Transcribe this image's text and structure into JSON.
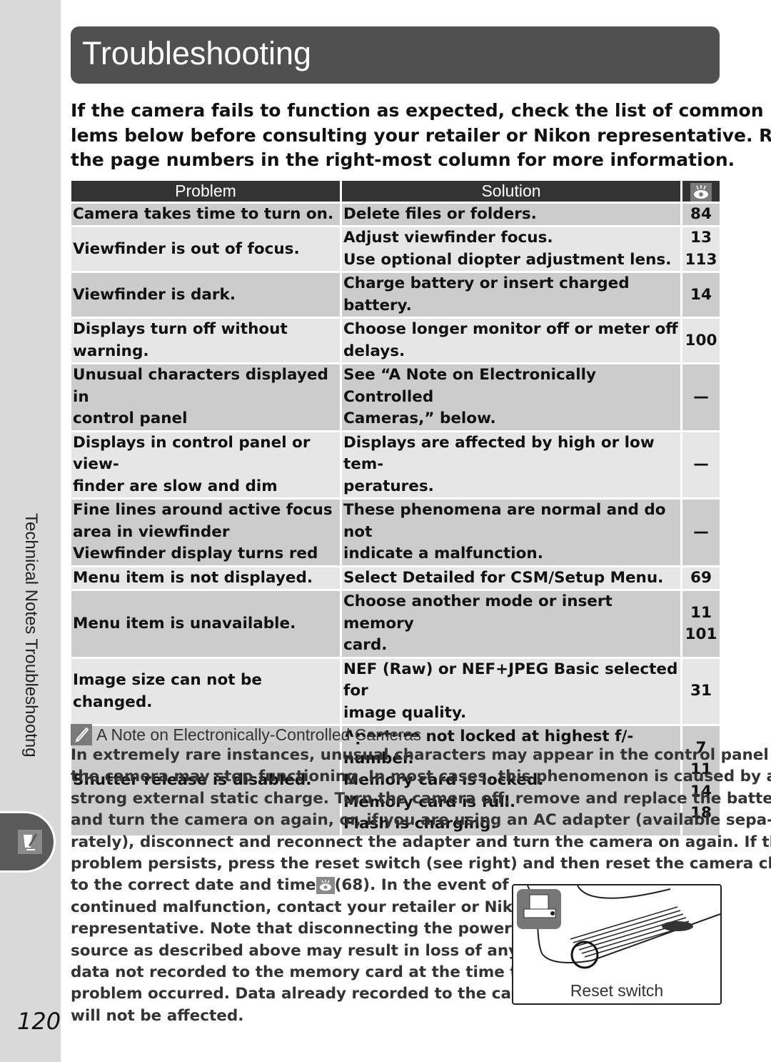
{
  "page": {
    "title": "Troubleshooting",
    "number": "120",
    "side_label": "Technical Notes Troubleshootng"
  },
  "intro": {
    "lines": [
      "If the camera fails to function as expected, check the list of common prob-",
      "lems below before consulting your retailer or Nikon representative.  Refer to",
      "the page numbers in the right-most column for more information."
    ]
  },
  "table": {
    "headers": {
      "problem": "Problem",
      "solution": "Solution",
      "page_icon": "eye-icon"
    },
    "rows": [
      {
        "problem": [
          "Camera takes time to turn on."
        ],
        "solutions": [
          "Delete files or folders."
        ],
        "pages": [
          "84"
        ]
      },
      {
        "problem": [
          "Viewfinder is out of focus."
        ],
        "solutions": [
          "Adjust viewfinder focus.",
          "Use optional diopter adjustment lens."
        ],
        "pages": [
          "13",
          "113"
        ]
      },
      {
        "problem": [
          "Viewfinder is dark."
        ],
        "solutions": [
          "Charge battery or insert charged battery."
        ],
        "pages": [
          "14"
        ]
      },
      {
        "problem": [
          "Displays turn off without warning."
        ],
        "solutions": [
          "Choose longer monitor off or meter off",
          "delays."
        ],
        "pages": [
          "100"
        ]
      },
      {
        "problem": [
          "Unusual characters displayed in",
          "control panel"
        ],
        "solutions": [
          "See “A Note on Electronically Controlled",
          "Cameras,” below."
        ],
        "pages": [
          "—"
        ]
      },
      {
        "problem": [
          "Displays in control panel or view-",
          "finder are slow and dim"
        ],
        "solutions": [
          "Displays are affected by high or low tem-",
          "peratures."
        ],
        "pages": [
          "—"
        ]
      },
      {
        "problem": [
          "Fine lines around active focus",
          " area in viewfinder",
          "Viewfinder display turns red"
        ],
        "solutions": [
          "These phenomena are normal and do not",
          "indicate a malfunction."
        ],
        "pages": [
          "—"
        ]
      },
      {
        "problem": [
          "Menu item is not displayed."
        ],
        "solutions": [
          "Select Detailed for CSM/Setup Menu."
        ],
        "pages": [
          "69"
        ]
      },
      {
        "problem": [
          "Menu item is unavailable."
        ],
        "solutions": [
          "Choose another mode or insert memory",
          "card."
        ],
        "pages": [
          "11",
          "101"
        ]
      },
      {
        "problem": [
          "Image size can not be changed."
        ],
        "solutions": [
          "NEF (Raw) or NEF+JPEG Basic selected for",
          "image quality."
        ],
        "pages": [
          "31"
        ]
      },
      {
        "problem": [
          "Shutter release is disabled."
        ],
        "solutions": [
          "Aperture not locked at highest f/-number.",
          "Memory card is locked.",
          "Memory card is full.",
          "Flash is charging."
        ],
        "pages": [
          "7",
          "11",
          "14",
          "18"
        ]
      }
    ]
  },
  "note": {
    "icon": "pencil-note-icon",
    "title": "A Note on Electronically-Controlled Cameras",
    "lines": [
      "In extremely rare instances, unusual characters may appear in the control panel and",
      "the camera may stop functioning.  In most cases, this phenomenon is caused by a",
      "strong external static charge.  Turn the camera off, remove and replace the battery,",
      "and turn the camera on again, or, if you are using an AC adapter (available sepa-",
      "rately), disconnect and reconnect the adapter and turn the camera on again.  If the",
      "problem persists, press the reset switch (see right) and then reset the camera clock",
      "to the correct date and time",
      "continued malfunction, contact your retailer or Nikon",
      "representative.   Note that disconnecting the power",
      "source as described above may result in loss of any",
      "data not recorded to the memory card at the time the",
      "problem occurred.  Data already recorded to the card",
      "will not be affected."
    ],
    "ref_page": "(68).  In the event of",
    "figure_caption": "Reset switch"
  }
}
